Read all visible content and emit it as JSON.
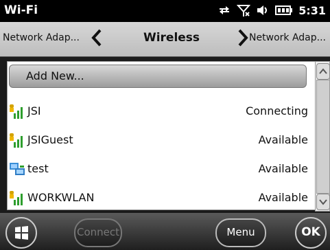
{
  "status": {
    "title": "Wi-Fi",
    "time": "5:31"
  },
  "nav": {
    "left": "Network Adap...",
    "title": "Wireless",
    "right": "Network Adap..."
  },
  "list": {
    "add_new": "Add New...",
    "rows": [
      {
        "name": "JSI",
        "status": "Connecting",
        "icon": "secure-signal-icon"
      },
      {
        "name": "JSIGuest",
        "status": "Available",
        "icon": "secure-signal-icon"
      },
      {
        "name": "test",
        "status": "Available",
        "icon": "adhoc-network-icon"
      },
      {
        "name": "WORKWLAN",
        "status": "Available",
        "icon": "secure-signal-icon"
      }
    ]
  },
  "bottom": {
    "connect": "Connect",
    "menu": "Menu",
    "ok": "OK"
  }
}
